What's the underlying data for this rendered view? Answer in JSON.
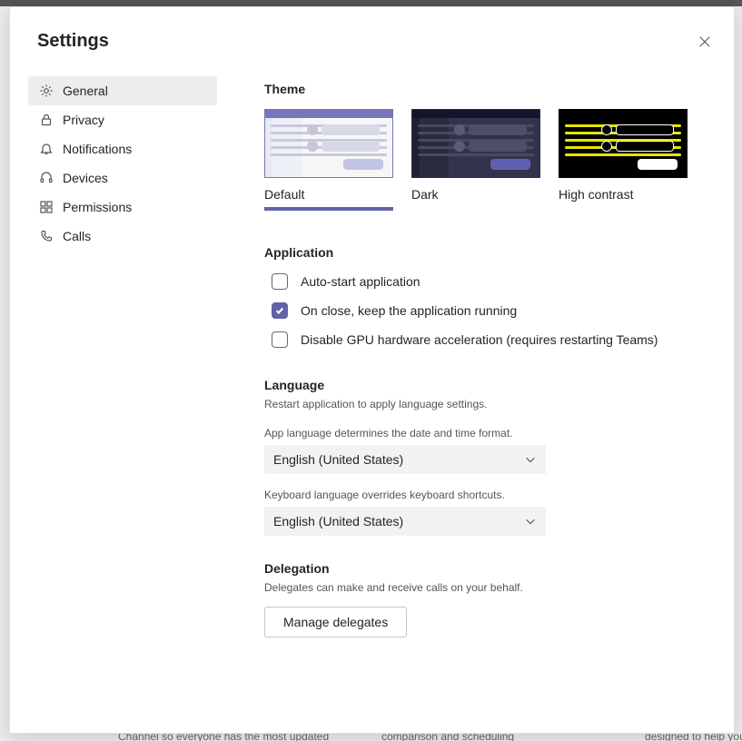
{
  "dialog": {
    "title": "Settings"
  },
  "nav": {
    "items": [
      {
        "label": "General"
      },
      {
        "label": "Privacy"
      },
      {
        "label": "Notifications"
      },
      {
        "label": "Devices"
      },
      {
        "label": "Permissions"
      },
      {
        "label": "Calls"
      }
    ]
  },
  "theme": {
    "heading": "Theme",
    "options": [
      {
        "label": "Default"
      },
      {
        "label": "Dark"
      },
      {
        "label": "High contrast"
      }
    ]
  },
  "application": {
    "heading": "Application",
    "options": [
      {
        "label": "Auto-start application",
        "checked": false
      },
      {
        "label": "On close, keep the application running",
        "checked": true
      },
      {
        "label": "Disable GPU hardware acceleration (requires restarting Teams)",
        "checked": false
      }
    ]
  },
  "language": {
    "heading": "Language",
    "restart_hint": "Restart application to apply language settings.",
    "app_lang_hint": "App language determines the date and time format.",
    "app_lang_value": "English (United States)",
    "kbd_hint": "Keyboard language overrides keyboard shortcuts.",
    "kbd_value": "English (United States)"
  },
  "delegation": {
    "heading": "Delegation",
    "hint": "Delegates can make and receive calls on your behalf.",
    "button": "Manage delegates"
  },
  "background_text": {
    "a": "Channel so everyone has the most updated",
    "b": "comparison and scheduling",
    "c": "designed to help you"
  },
  "colors": {
    "accent": "#6264A7"
  }
}
